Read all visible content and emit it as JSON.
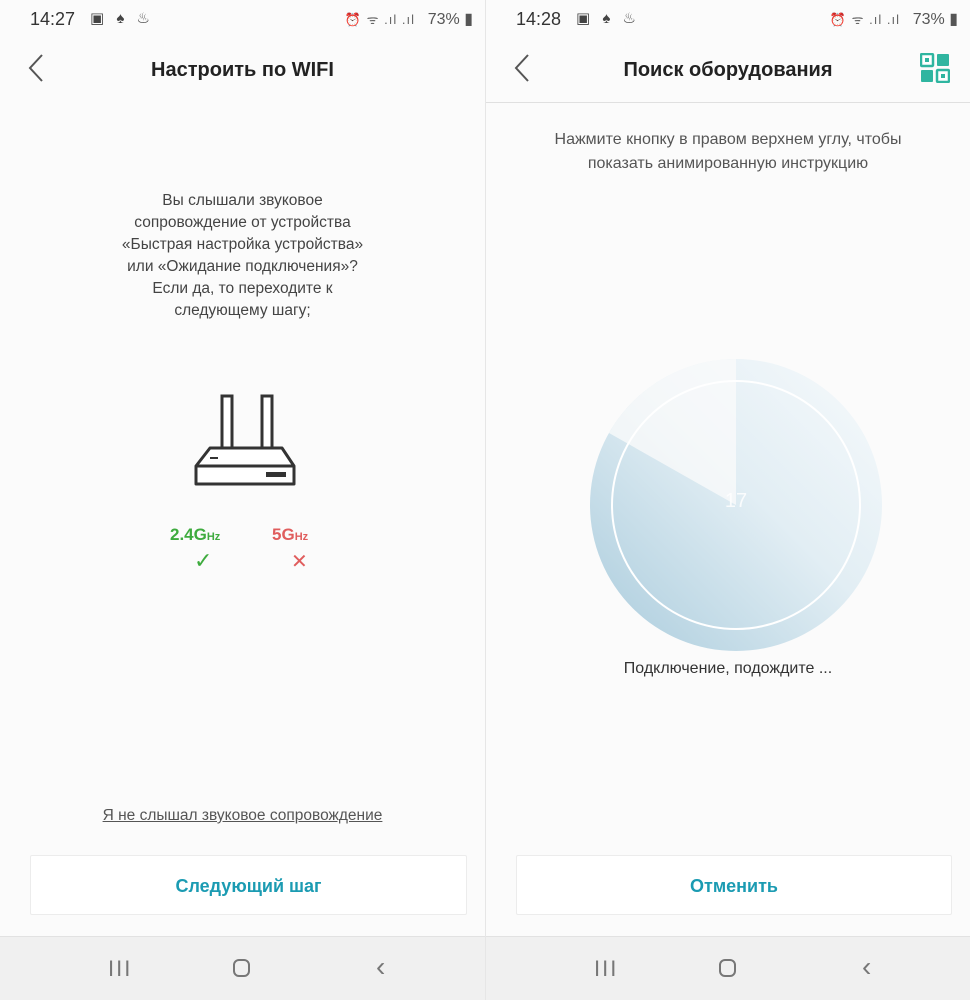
{
  "left_screen": {
    "status": {
      "time": "14:27",
      "left_icons": "▣ ♠ ♨",
      "right_icons": "⏰ ᯤ .ıl .ıl",
      "battery": "73% ▮"
    },
    "title": "Настроить по WIFI",
    "prompt_lines": [
      "Вы слышали звуковое",
      "сопровождение от устройства",
      "«Быстрая настройка устройства»",
      "или «Ожидание подключения»?",
      "Если да, то переходите к",
      "следующему шагу;"
    ],
    "band_24": {
      "value": "2.4G",
      "unit": "Hz"
    },
    "band_5": {
      "value": "5G",
      "unit": "Hz"
    },
    "check_mark": "✓",
    "cross_mark": "✕",
    "no_sound_link": "Я не слышал звуковое сопровождение",
    "next_button": "Следующий шаг"
  },
  "right_screen": {
    "status": {
      "time": "14:28",
      "left_icons": "▣ ♠ ♨",
      "right_icons": "⏰ ᯤ .ıl .ıl",
      "battery": "73% ▮"
    },
    "title": "Поиск оборудования",
    "hint_lines": [
      "Нажмите кнопку в правом верхнем углу, чтобы",
      "показать анимированную инструкцию"
    ],
    "progress": "17",
    "connecting_text": "Подключение, подождите ...",
    "cancel_button": "Отменить"
  },
  "nav": {
    "recent": "III",
    "back": "‹"
  },
  "colors": {
    "accent": "#1b9bb2",
    "ok": "#3eab3e",
    "bad": "#e05d5d",
    "radar": "#a9cbdc"
  },
  "icons": [
    "back-chevron-icon",
    "qr-instruction-icon",
    "router-icon",
    "check-icon",
    "cross-icon",
    "recent-apps-icon",
    "home-icon",
    "nav-back-icon"
  ]
}
